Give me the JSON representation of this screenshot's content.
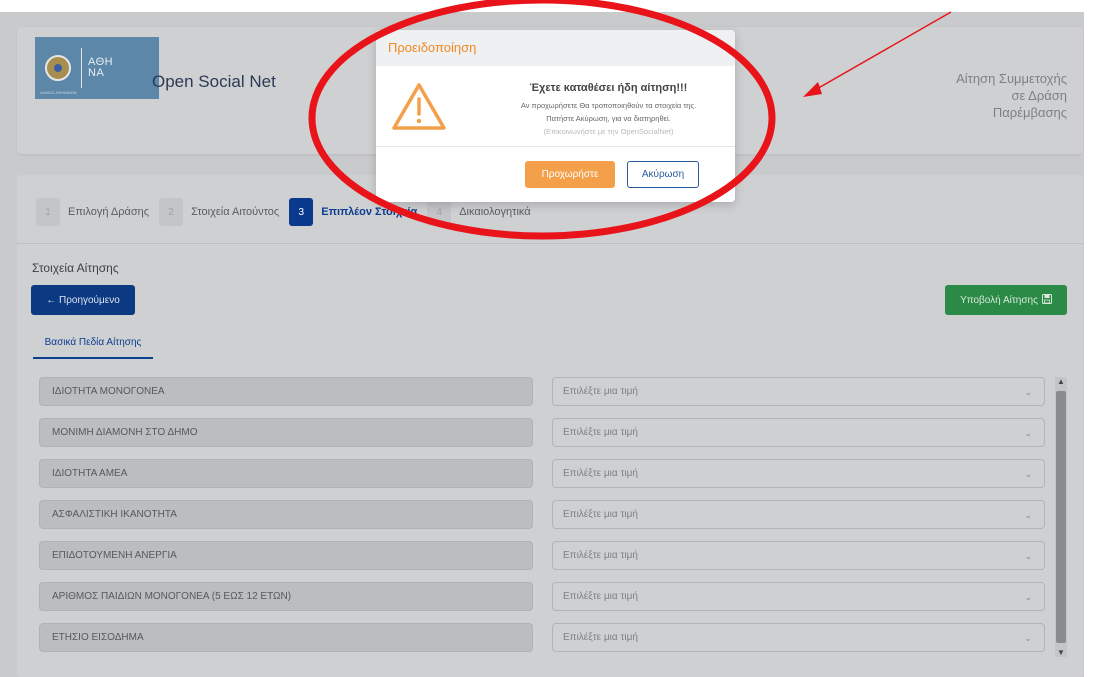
{
  "brand": {
    "logo_text_line1": "ΑΘΗ",
    "logo_text_line2": "ΝΑ",
    "logo_small": "ΔΗΜΟΣ ΑΘΗΝΑΙΩΝ",
    "title": "Open Social Net"
  },
  "header": {
    "action_title": "Αίτηση Συμμετοχής σε Δράση Παρέμβασης"
  },
  "steps": [
    {
      "num": "1",
      "label": "Επιλογή Δράσης"
    },
    {
      "num": "2",
      "label": "Στοιχεία Αιτούντος"
    },
    {
      "num": "3",
      "label": "Επιπλέον Στοιχεία"
    },
    {
      "num": "4",
      "label": "Δικαιολογητικά"
    }
  ],
  "section": {
    "label": "Στοιχεία Αίτησης",
    "prev_button": "← Προηγούμενο",
    "submit_button": "Υποβολή Αίτησης",
    "tab": "Βασικά Πεδία Αίτησης"
  },
  "fields": [
    {
      "label": "ΙΔΙΟΤΗΤΑ ΜΟΝΟΓΟΝΕΑ",
      "placeholder": "Επιλέξτε μια τιμή"
    },
    {
      "label": "ΜΟΝΙΜΗ ΔΙΑΜΟΝΗ ΣΤΟ ΔΗΜΟ",
      "placeholder": "Επιλέξτε μια τιμή"
    },
    {
      "label": "ΙΔΙΟΤΗΤΑ ΑΜΕΑ",
      "placeholder": "Επιλέξτε μια τιμή"
    },
    {
      "label": "ΑΣΦΑΛΙΣΤΙΚΗ ΙΚΑΝΟΤΗΤΑ",
      "placeholder": "Επιλέξτε μια τιμή"
    },
    {
      "label": "ΕΠΙΔΟΤΟΥΜΕΝΗ ΑΝΕΡΓΙΑ",
      "placeholder": "Επιλέξτε μια τιμή"
    },
    {
      "label": "ΑΡΙΘΜΟΣ ΠΑΙΔΙΩΝ ΜΟΝΟΓΟΝΕΑ (5 ΕΩΣ 12 ΕΤΩΝ)",
      "placeholder": "Επιλέξτε μια τιμή"
    },
    {
      "label": "ΕΤΗΣΙΟ ΕΙΣΟΔΗΜΑ",
      "placeholder": "Επιλέξτε μια τιμή"
    }
  ],
  "modal": {
    "title": "Προειδοποίηση",
    "heading": "Έχετε καταθέσει ήδη αίτηση!!!",
    "line1": "Αν προχωρήσετε Θα τροποποιηθούν τα στοιχεία της.",
    "line2": "Πατήστε Ακύρωση, για να διατηρηθεί.",
    "line3": "(Επικοινωνήστε με την OpenSocialNet)",
    "proceed": "Προχωρήστε",
    "cancel": "Ακύρωση"
  },
  "colors": {
    "primary": "#0c3a82",
    "success": "#2a8a46",
    "warning": "#f4a04a",
    "annotation": "#e8141a"
  }
}
